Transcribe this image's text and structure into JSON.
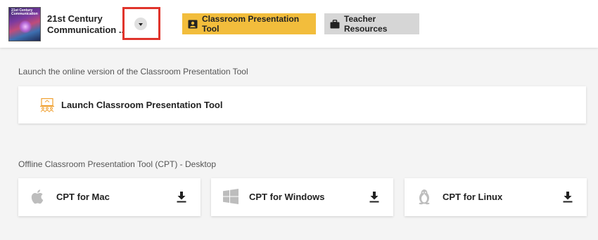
{
  "header": {
    "book": {
      "cover_text": "21st Century Communication",
      "title_line1": "21st Century",
      "title_line2": "Communication ..."
    },
    "nav": {
      "cpt_label": "Classroom Presentation Tool",
      "resources_label": "Teacher Resources"
    }
  },
  "online": {
    "section_label": "Launch the online version of the Classroom Presentation Tool",
    "launch_label": "Launch Classroom Presentation Tool"
  },
  "offline": {
    "section_label": "Offline Classroom Presentation Tool (CPT) - Desktop",
    "items": [
      {
        "label": "CPT for Mac",
        "icon": "apple-icon"
      },
      {
        "label": "CPT for Windows",
        "icon": "windows-icon"
      },
      {
        "label": "CPT for Linux",
        "icon": "linux-icon"
      }
    ]
  },
  "colors": {
    "accent": "#f2bd3c",
    "secondary_button": "#d6d6d6",
    "highlight": "#e0342c",
    "launch_icon": "#f0a030"
  }
}
